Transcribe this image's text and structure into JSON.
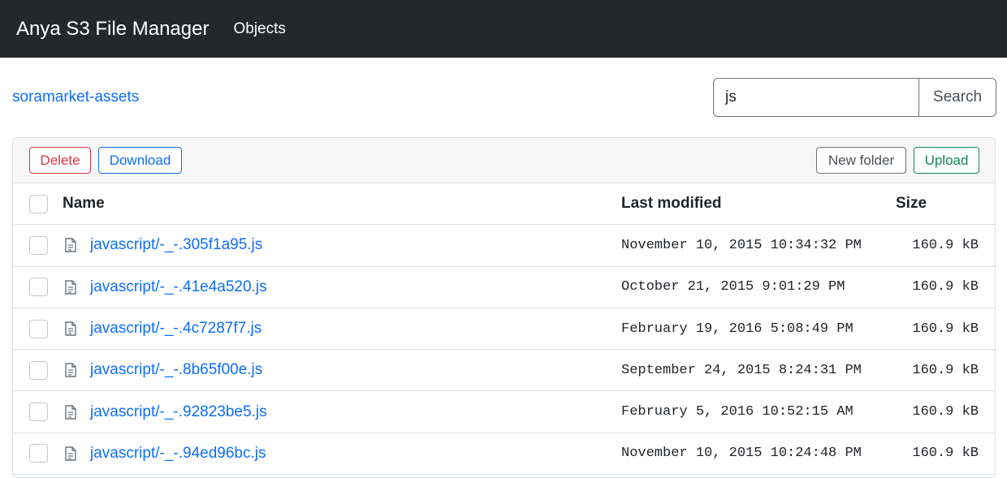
{
  "navbar": {
    "brand": "Anya S3 File Manager",
    "objects_link": "Objects"
  },
  "bucket": {
    "name": "soramarket-assets"
  },
  "search": {
    "value": "js",
    "button_label": "Search"
  },
  "toolbar": {
    "delete_label": "Delete",
    "download_label": "Download",
    "new_folder_label": "New folder",
    "upload_label": "Upload"
  },
  "table": {
    "headers": {
      "name": "Name",
      "last_modified": "Last modified",
      "size": "Size"
    },
    "rows": [
      {
        "name": "javascript/-_-.305f1a95.js",
        "last_modified": "November 10, 2015 10:34:32 PM",
        "size": "160.9 kB"
      },
      {
        "name": "javascript/-_-.41e4a520.js",
        "last_modified": "October 21, 2015 9:01:29 PM",
        "size": "160.9 kB"
      },
      {
        "name": "javascript/-_-.4c7287f7.js",
        "last_modified": "February 19, 2016 5:08:49 PM",
        "size": "160.9 kB"
      },
      {
        "name": "javascript/-_-.8b65f00e.js",
        "last_modified": "September 24, 2015 8:24:31 PM",
        "size": "160.9 kB"
      },
      {
        "name": "javascript/-_-.92823be5.js",
        "last_modified": "February 5, 2016 10:52:15 AM",
        "size": "160.9 kB"
      },
      {
        "name": "javascript/-_-.94ed96bc.js",
        "last_modified": "November 10, 2015 10:24:48 PM",
        "size": "160.9 kB"
      }
    ]
  },
  "colors": {
    "navbar_bg": "#25282b",
    "link": "#0d6efd",
    "danger": "#dc3545",
    "success": "#198754"
  },
  "icons": {
    "file": "file-text-icon"
  }
}
